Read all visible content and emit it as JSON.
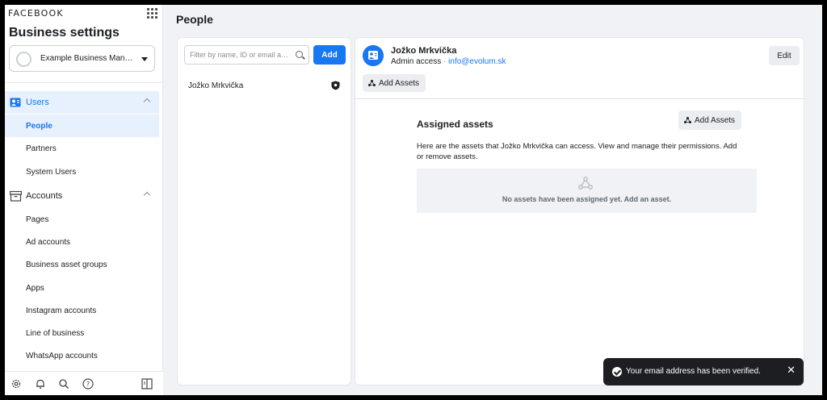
{
  "sidebar": {
    "brand": "FACEBOOK",
    "title": "Business settings",
    "business_name": "Example Business Manag…",
    "sections": [
      {
        "label": "Users",
        "icon": "users-icon",
        "items": [
          "People",
          "Partners",
          "System Users"
        ]
      },
      {
        "label": "Accounts",
        "icon": "archive-icon",
        "items": [
          "Pages",
          "Ad accounts",
          "Business asset groups",
          "Apps",
          "Instagram accounts",
          "Line of business",
          "WhatsApp accounts"
        ]
      }
    ],
    "active_item": "People",
    "bottom_icons": [
      "gear-icon",
      "bell-icon",
      "search-icon",
      "help-icon",
      "panel-toggle-icon"
    ]
  },
  "page": {
    "title": "People"
  },
  "list": {
    "filter_placeholder": "Filter by name, ID or email a…",
    "add_label": "Add",
    "people": [
      {
        "name": "Jožko Mrkvička",
        "badge_icon": "shield-icon"
      }
    ]
  },
  "detail": {
    "name": "Jožko Mrkvička",
    "access": "Admin access",
    "separator": "·",
    "email": "info@evolum.sk",
    "edit_label": "Edit",
    "add_assets_label": "Add Assets",
    "assigned_title": "Assigned assets",
    "assigned_add_label": "Add Assets",
    "assigned_desc": "Here are the assets that Jožko Mrkvička can access. View and manage their permissions. Add or remove assets.",
    "empty_text": "No assets have been assigned yet. Add an asset."
  },
  "toast": {
    "text": "Your email address has been verified.",
    "close": "✕"
  },
  "colors": {
    "accent": "#1877f2",
    "active_bg": "#e7f0fd",
    "toast_bg": "#1c1e21"
  }
}
